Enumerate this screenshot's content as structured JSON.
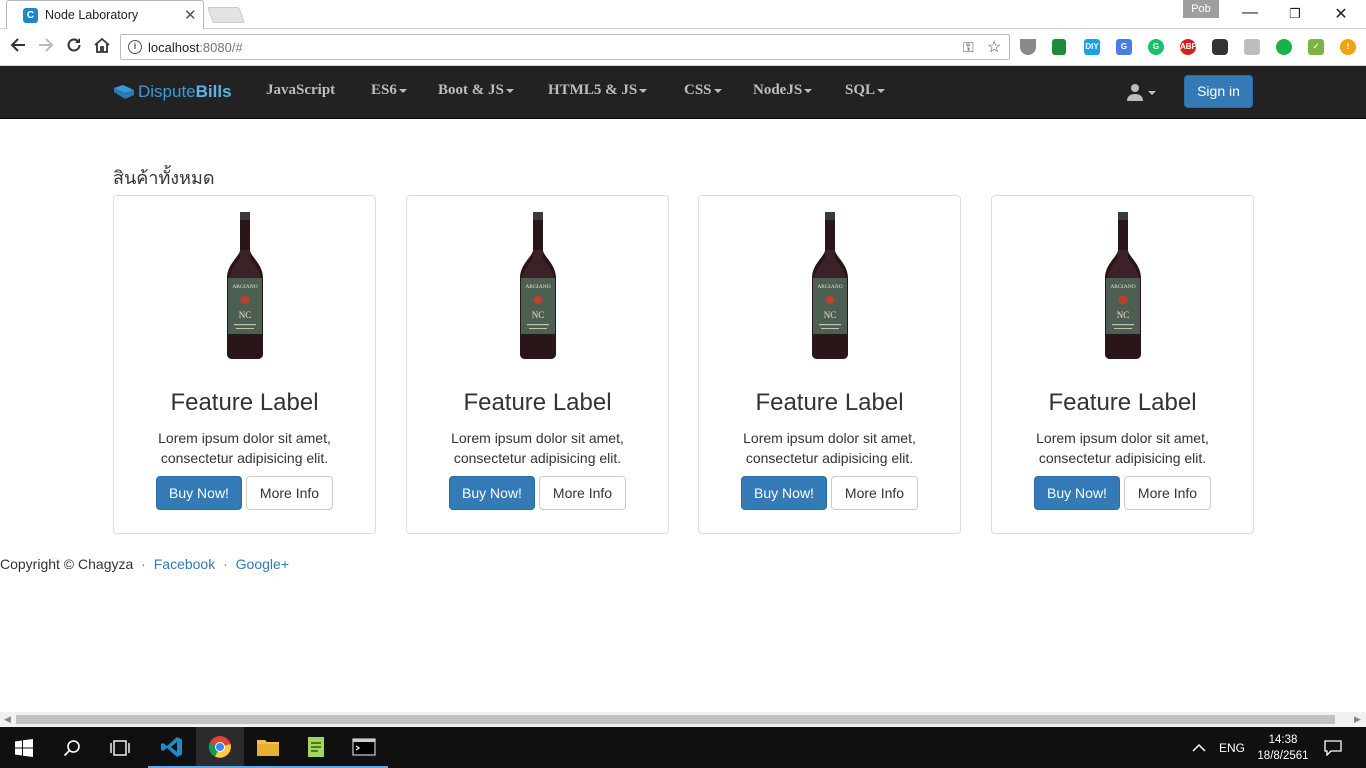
{
  "browser": {
    "tab_title": "Node Laboratory",
    "tab_close": "✕",
    "profile_name": "Pob",
    "url_host": "localhost",
    "url_rest": ":8080/#",
    "window_controls": [
      "—",
      "❐",
      "✕"
    ]
  },
  "navbar": {
    "brand_part1": "Dispute",
    "brand_part2": "Bills",
    "items": [
      {
        "label": "JavaScript",
        "dropdown": false
      },
      {
        "label": "ES6",
        "dropdown": true
      },
      {
        "label": "Boot & JS",
        "dropdown": true
      },
      {
        "label": "HTML5 & JS",
        "dropdown": true
      },
      {
        "label": "CSS",
        "dropdown": true
      },
      {
        "label": "NodeJS",
        "dropdown": true
      },
      {
        "label": "SQL",
        "dropdown": true
      }
    ],
    "signin_label": "Sign in"
  },
  "main": {
    "section_title": "สินค้าทั้งหมด",
    "cards": [
      {
        "title": "Feature Label",
        "text": "Lorem ipsum dolor sit amet, consectetur adipisicing elit.",
        "buy_label": "Buy Now!",
        "info_label": "More Info",
        "bottle_label": "ARGIANO"
      },
      {
        "title": "Feature Label",
        "text": "Lorem ipsum dolor sit amet, consectetur adipisicing elit.",
        "buy_label": "Buy Now!",
        "info_label": "More Info",
        "bottle_label": "ARGIANO"
      },
      {
        "title": "Feature Label",
        "text": "Lorem ipsum dolor sit amet, consectetur adipisicing elit.",
        "buy_label": "Buy Now!",
        "info_label": "More Info",
        "bottle_label": "ARGIANO"
      },
      {
        "title": "Feature Label",
        "text": "Lorem ipsum dolor sit amet, consectetur adipisicing elit.",
        "buy_label": "Buy Now!",
        "info_label": "More Info",
        "bottle_label": "ARGIANO"
      }
    ]
  },
  "footer": {
    "copyright": "Copyright © Chagyza",
    "separator": "·",
    "links": [
      "Facebook",
      "Google+"
    ]
  },
  "taskbar": {
    "language": "ENG",
    "time": "14:38",
    "date": "18/8/2561"
  },
  "colors": {
    "navbar_bg": "#222222",
    "primary": "#337ab7",
    "brand": "#3a9ad9"
  }
}
